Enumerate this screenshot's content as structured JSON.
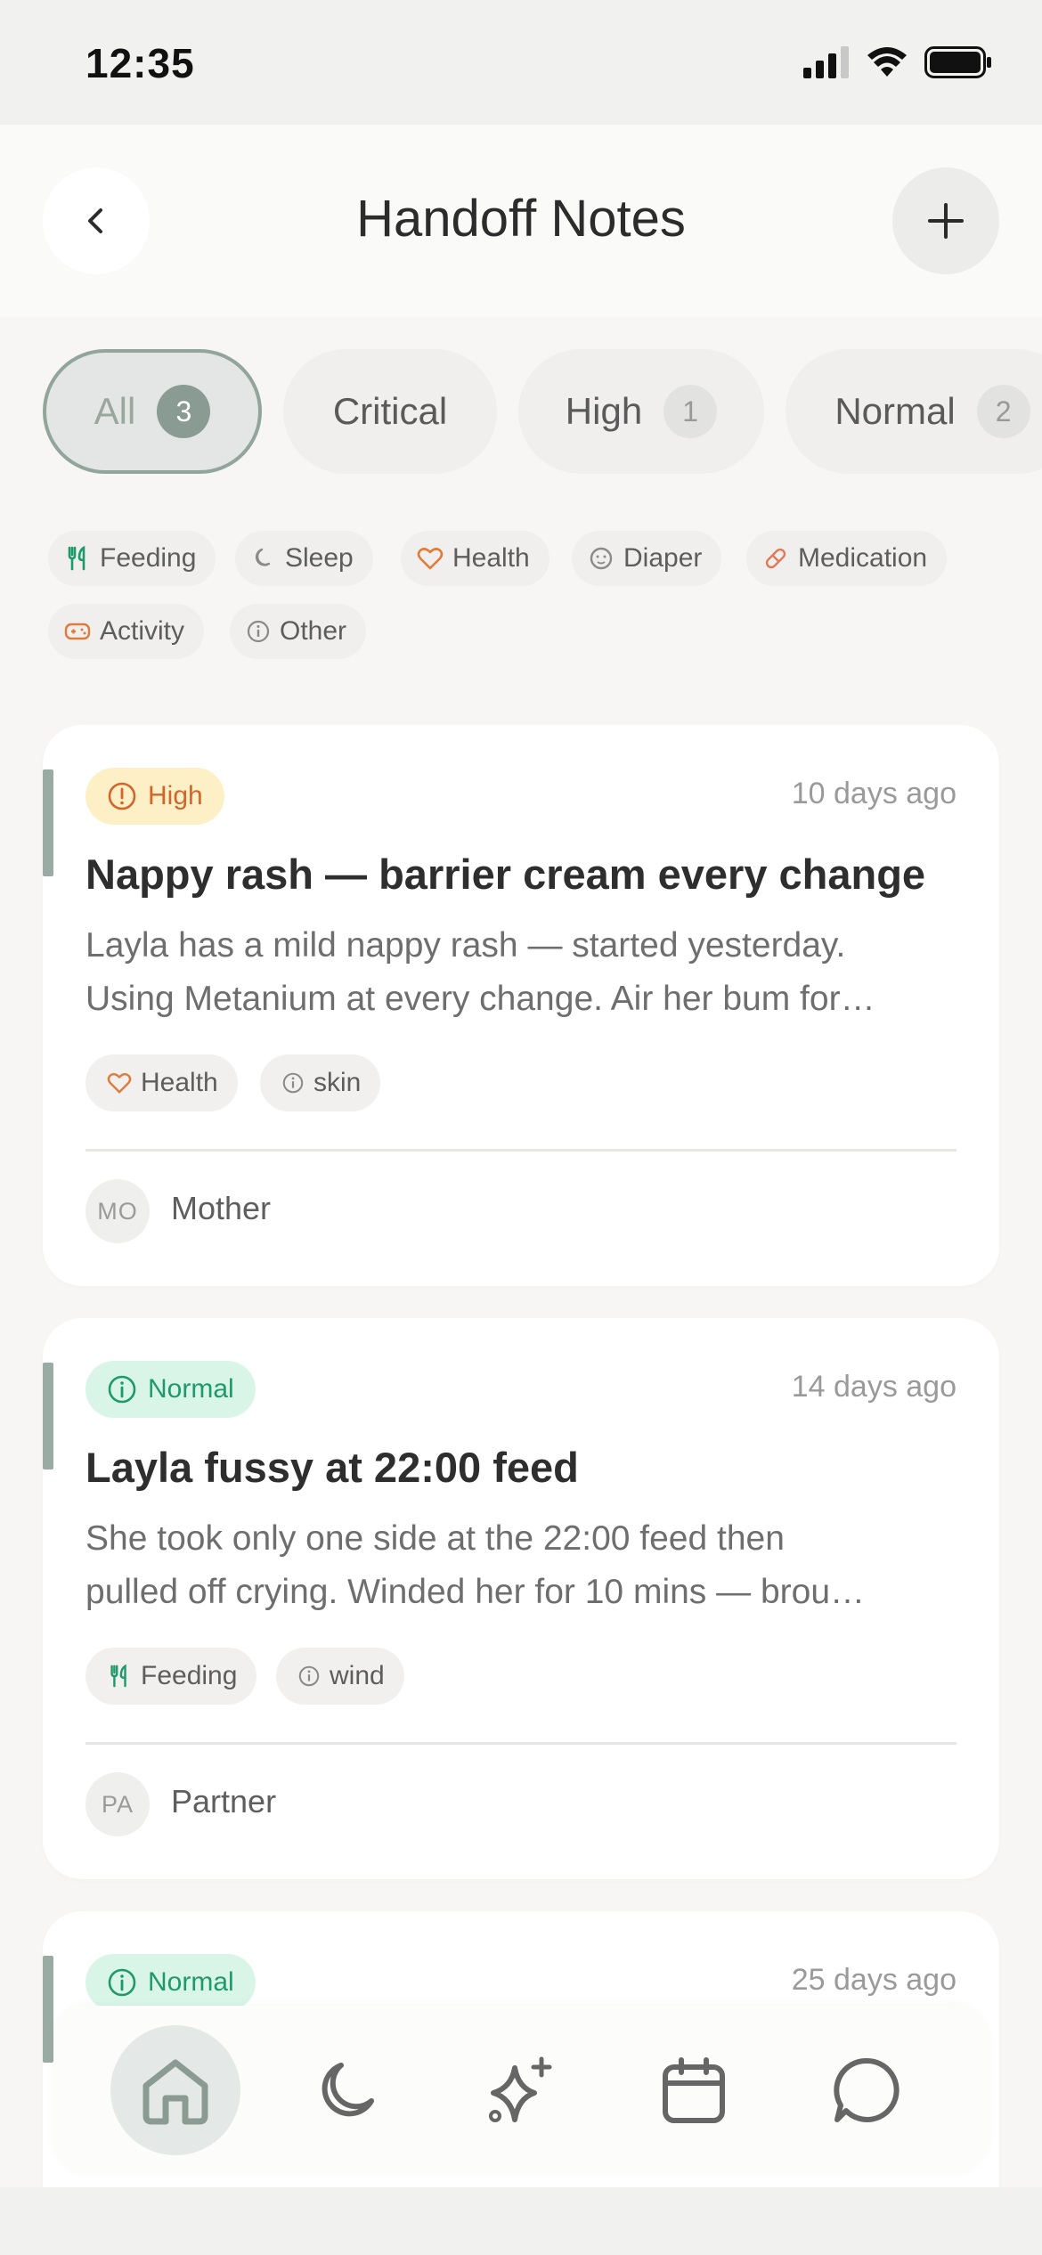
{
  "status_bar": {
    "time": "12:35"
  },
  "header": {
    "title": "Handoff Notes"
  },
  "segments": [
    {
      "label": "All",
      "count": "3"
    },
    {
      "label": "Critical",
      "count": ""
    },
    {
      "label": "High",
      "count": "1"
    },
    {
      "label": "Normal",
      "count": "2"
    }
  ],
  "categories": [
    {
      "label": "Feeding",
      "icon": "fork-knife-icon",
      "color": "#1e9a6a"
    },
    {
      "label": "Sleep",
      "icon": "moon-icon",
      "color": "#8a8a8a"
    },
    {
      "label": "Health",
      "icon": "heart-icon",
      "color": "#e07b3a"
    },
    {
      "label": "Diaper",
      "icon": "baby-face-icon",
      "color": "#8a8a8a"
    },
    {
      "label": "Medication",
      "icon": "pill-icon",
      "color": "#e0785a"
    },
    {
      "label": "Activity",
      "icon": "gamepad-icon",
      "color": "#e07b3a"
    },
    {
      "label": "Other",
      "icon": "info-icon",
      "color": "#8a8a8a"
    }
  ],
  "notes": [
    {
      "priority": "High",
      "time": "10 days ago",
      "title": "Nappy rash — barrier cream every change",
      "body_line1": "Layla has a mild nappy rash — started yesterday.",
      "body_line2": "Using Metanium at every change. Air her bum for…",
      "tags": [
        "Health",
        "skin"
      ],
      "author_initials": "MO",
      "author": "Mother"
    },
    {
      "priority": "Normal",
      "time": "14 days ago",
      "title": "Layla fussy at 22:00 feed",
      "body_line1": "She took only one side at the 22:00 feed then",
      "body_line2": "pulled off crying. Winded her for 10 mins — brou…",
      "tags": [
        "Feeding",
        "wind"
      ],
      "author_initials": "PA",
      "author": "Partner"
    },
    {
      "priority": "Normal",
      "time": "25 days ago"
    }
  ],
  "nav": {
    "items": [
      "home-icon",
      "moon-icon",
      "sparkle-icon",
      "calendar-icon",
      "chat-icon"
    ],
    "active": "home"
  },
  "colors": {
    "accent": "#8a9b93",
    "high": "#d2662a",
    "normal": "#1e9a6a"
  }
}
